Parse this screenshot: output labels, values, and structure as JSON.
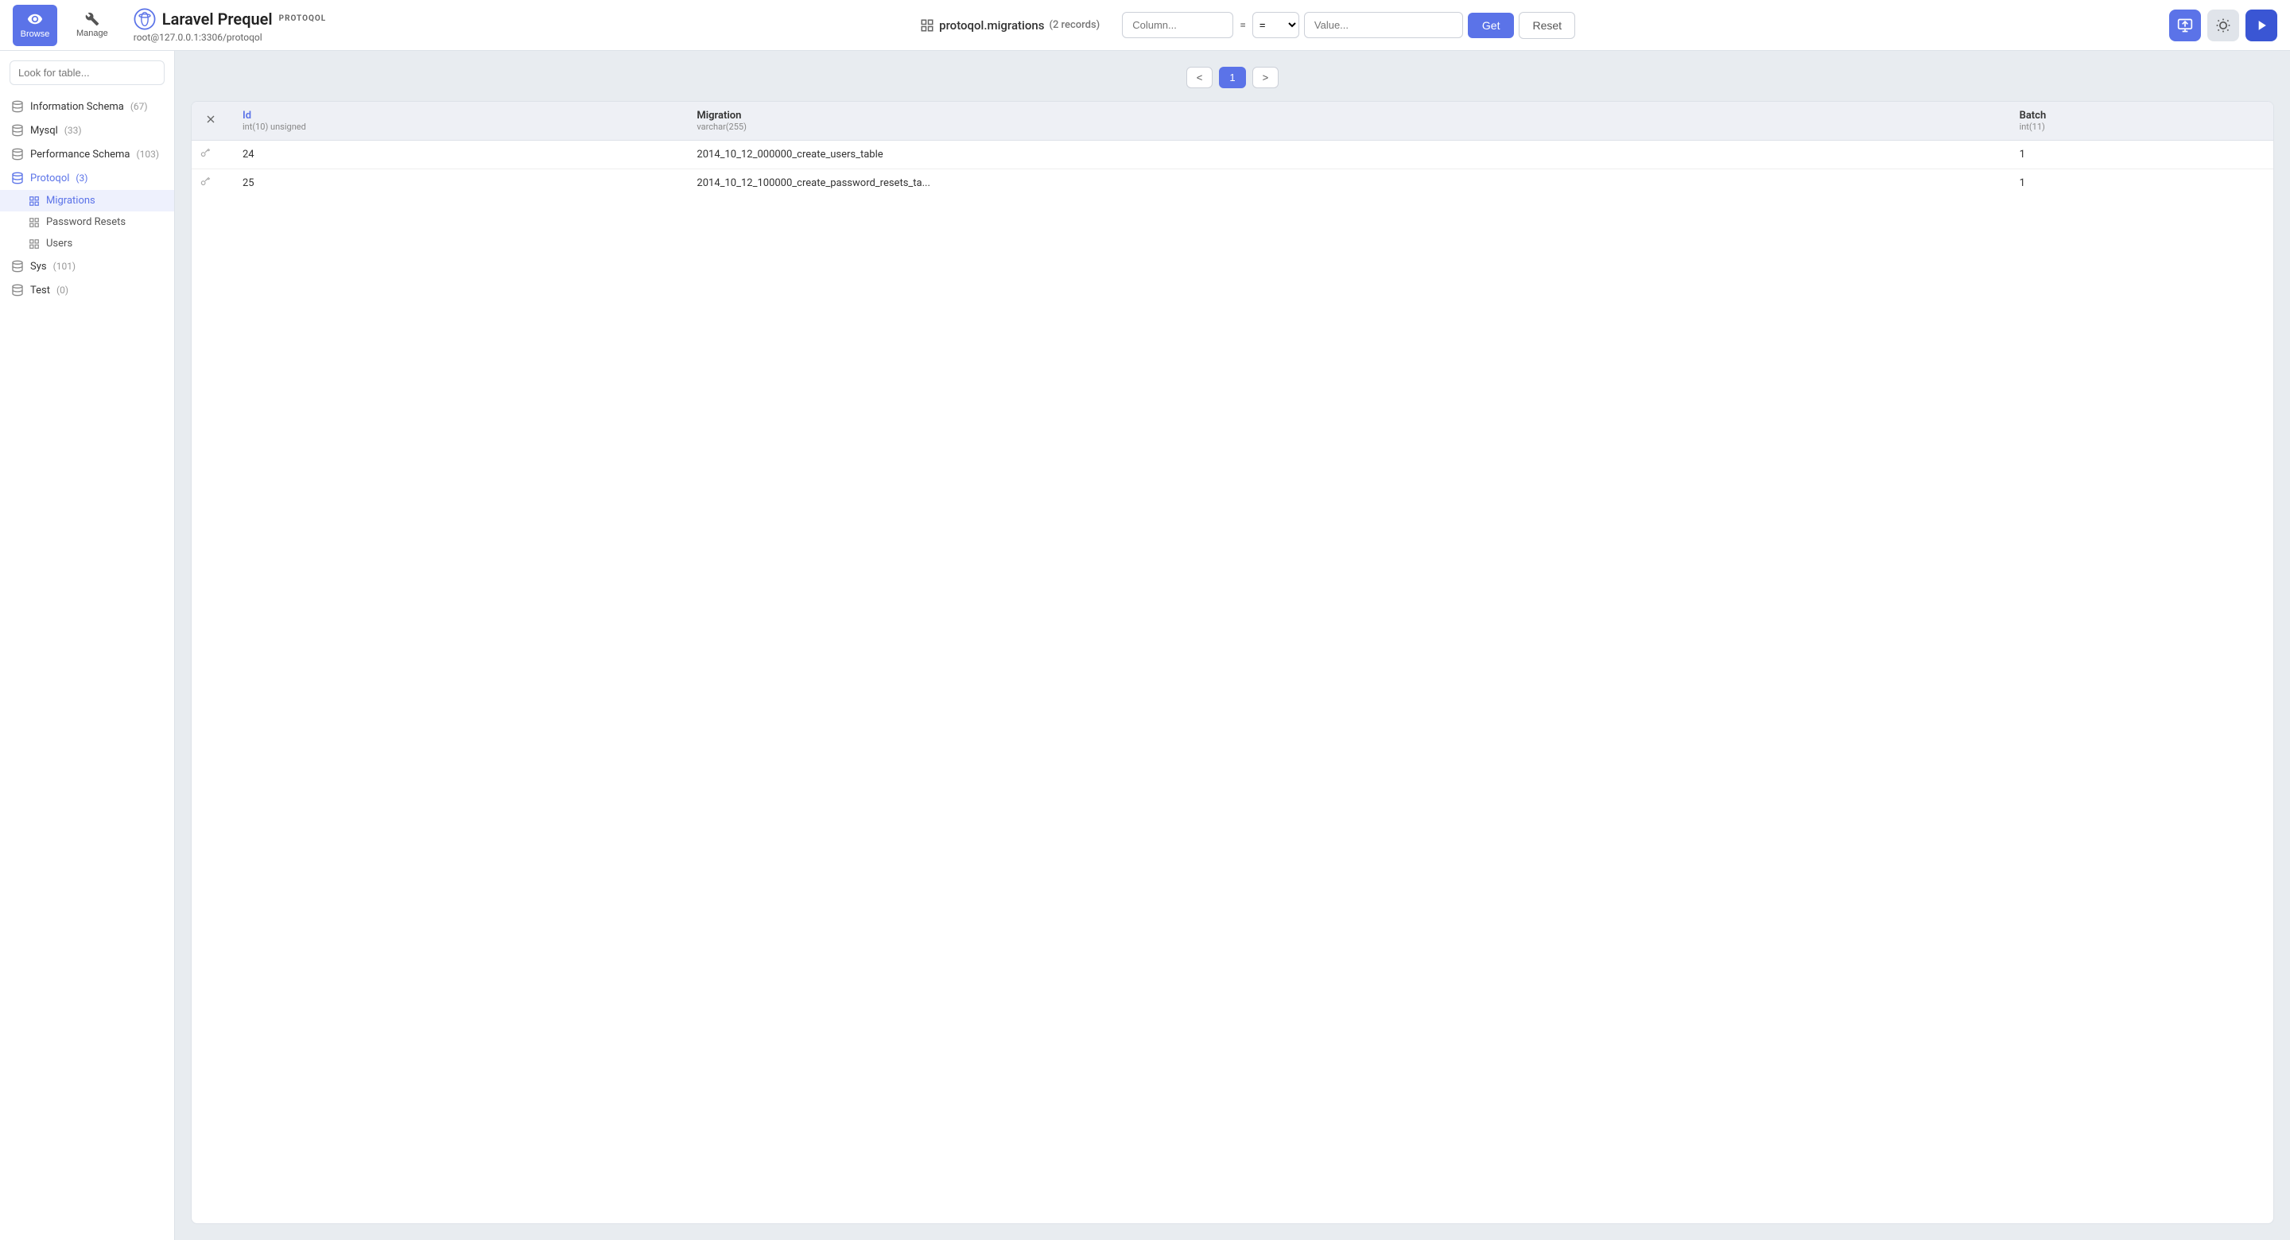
{
  "app": {
    "name": "Laravel Prequel",
    "tag": "PROTOQOL",
    "connection": "root@127.0.0.1:3306/protoqol"
  },
  "topbar": {
    "browse_label": "Browse",
    "manage_label": "Manage",
    "table_display": "protoqol.migrations",
    "records_count": "(2 records)",
    "column_placeholder": "Column...",
    "operator": "=",
    "value_placeholder": "Value...",
    "get_label": "Get",
    "reset_label": "Reset"
  },
  "pagination": {
    "prev": "<",
    "current": "1",
    "next": ">"
  },
  "table": {
    "columns": [
      {
        "name": "Id",
        "type": "int(10) unsigned"
      },
      {
        "name": "Migration",
        "type": "varchar(255)"
      },
      {
        "name": "Batch",
        "type": "int(11)"
      }
    ],
    "rows": [
      {
        "id": "24",
        "migration": "2014_10_12_000000_create_users_table",
        "batch": "1"
      },
      {
        "id": "25",
        "migration": "2014_10_12_100000_create_password_resets_ta...",
        "batch": "1"
      }
    ]
  },
  "sidebar": {
    "search_placeholder": "Look for table...",
    "databases": [
      {
        "name": "Information Schema",
        "count": "(67)",
        "active": false,
        "tables": []
      },
      {
        "name": "Mysql",
        "count": "(33)",
        "active": false,
        "tables": []
      },
      {
        "name": "Performance Schema",
        "count": "(103)",
        "active": false,
        "tables": []
      },
      {
        "name": "Protoqol",
        "count": "(3)",
        "active": true,
        "tables": [
          {
            "name": "Migrations",
            "active": true
          },
          {
            "name": "Password Resets",
            "active": false
          },
          {
            "name": "Users",
            "active": false
          }
        ]
      },
      {
        "name": "Sys",
        "count": "(101)",
        "active": false,
        "tables": []
      },
      {
        "name": "Test",
        "count": "(0)",
        "active": false,
        "tables": []
      }
    ]
  }
}
